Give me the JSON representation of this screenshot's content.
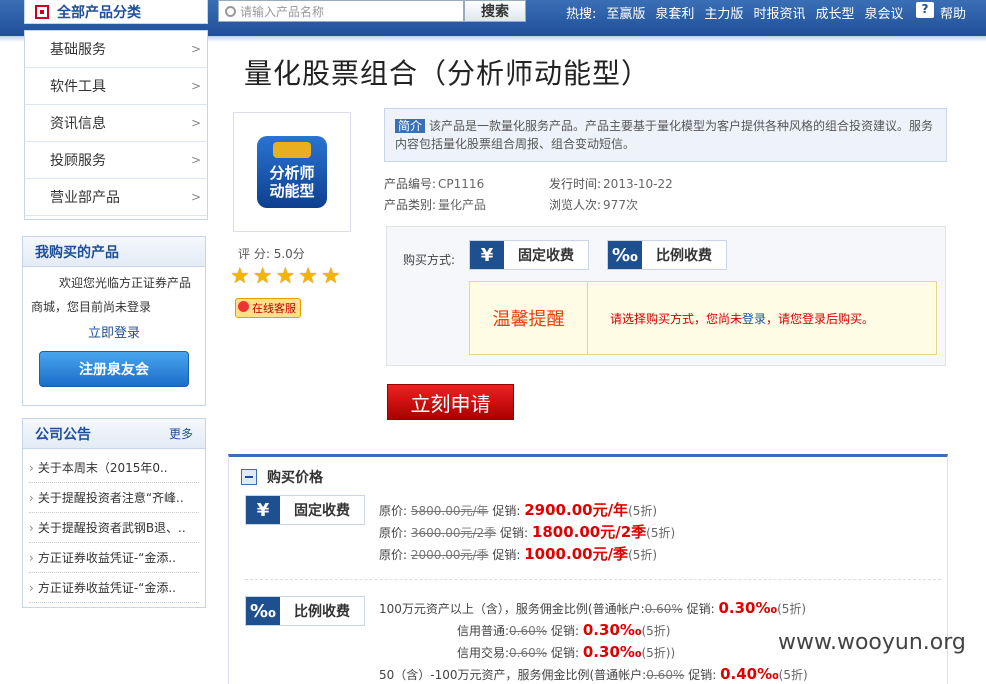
{
  "topbar": {
    "all_categories": "全部产品分类",
    "search_placeholder": "请输入产品名称",
    "search_button": "搜索",
    "hot_label": "热搜:",
    "hot_links": [
      "至赢版",
      "泉套利",
      "主力版",
      "时报资讯",
      "成长型",
      "泉会议"
    ],
    "help": "帮助",
    "help_icon": "?"
  },
  "categories": [
    {
      "label": "基础服务",
      "arrow": ">"
    },
    {
      "label": "软件工具",
      "arrow": ">"
    },
    {
      "label": "资讯信息",
      "arrow": ">"
    },
    {
      "label": "投顾服务",
      "arrow": ">"
    },
    {
      "label": "营业部产品",
      "arrow": ">"
    }
  ],
  "my_products": {
    "title": "我购买的产品",
    "welcome_line1": "欢迎您光临方正证券产品",
    "welcome_line2": "商城，您目前尚未登录",
    "login_link": "立即登录",
    "register_button": "注册泉友会"
  },
  "notice": {
    "title": "公司公告",
    "more": "更多",
    "items": [
      "关于本周末（2015年0..",
      "关于提醒投资者注意“齐峰..",
      "关于提醒投资者武钢B退、..",
      "方正证券收益凭证-“金添..",
      "方正证券收益凭证-“金添.."
    ]
  },
  "product": {
    "title": "量化股票组合（分析师动能型）",
    "icon_text_line1": "分析师",
    "icon_text_line2": "动能型",
    "score_label": "评 分:",
    "score_value": "5.0分",
    "stars": [
      "★",
      "★",
      "★",
      "★",
      "★"
    ],
    "service_button": "在线客服",
    "intro_tag": "简介",
    "intro_text": "该产品是一款量化服务产品。产品主要基于量化模型为客户提供各种风格的组合投资建议。服务内容包括量化股票组合周报、组合变动短信。",
    "code_label": "产品编号:",
    "code_value": "CP1116",
    "type_label": "产品类别:",
    "type_value": "量化产品",
    "date_label": "发行时间:",
    "date_value": "2013-10-22",
    "views_label": "浏览人次:",
    "views_value": "977次"
  },
  "buy": {
    "method_label": "购买方式:",
    "fixed_symbol": "¥",
    "fixed_label": "固定收费",
    "ratio_symbol": "‰",
    "ratio_label": "比例收费",
    "remind_title": "温馨提醒",
    "remind_msg_1": "请选择购买方式，您尚未",
    "remind_login": "登录",
    "remind_msg_2": "，请您登录后购买。",
    "apply_button": "立刻申请"
  },
  "price": {
    "title": "购买价格",
    "fixed_symbol": "¥",
    "fixed_label": "固定收费",
    "ratio_symbol": "‰",
    "ratio_label": "比例收费",
    "fixed_rows": [
      {
        "orig_label": "原价:",
        "orig": "5800.00元/年",
        "promo_label": "促销:",
        "promo": "2900.00元/年",
        "discount": "(5折)"
      },
      {
        "orig_label": "原价:",
        "orig": "3600.00元/2季",
        "promo_label": "促销:",
        "promo": "1800.00元/2季",
        "discount": "(5折)"
      },
      {
        "orig_label": "原价:",
        "orig": "2000.00元/季",
        "promo_label": "促销:",
        "promo": "1000.00元/季",
        "discount": "(5折)"
      }
    ],
    "ratio_rows": [
      {
        "prefix": "100万元资产以上（含），服务佣金比例(普通帐户:",
        "orig": "0.60%",
        "promo_label": "促销:",
        "promo": "0.30‰",
        "discount": "(5折)"
      },
      {
        "prefix": "信用普通:",
        "orig": "0.60%",
        "promo_label": "促销:",
        "promo": "0.30‰",
        "discount": "(5折)"
      },
      {
        "prefix": "信用交易:",
        "orig": "0.60%",
        "promo_label": "促销:",
        "promo": "0.30‰",
        "discount": "(5折))"
      },
      {
        "prefix": "50（含）-100万元资产，服务佣金比例(普通帐户:",
        "orig": "0.60%",
        "promo_label": "促销:",
        "promo": "0.40‰",
        "discount": "(5折)"
      }
    ]
  },
  "watermark": "www.wooyun.org"
}
